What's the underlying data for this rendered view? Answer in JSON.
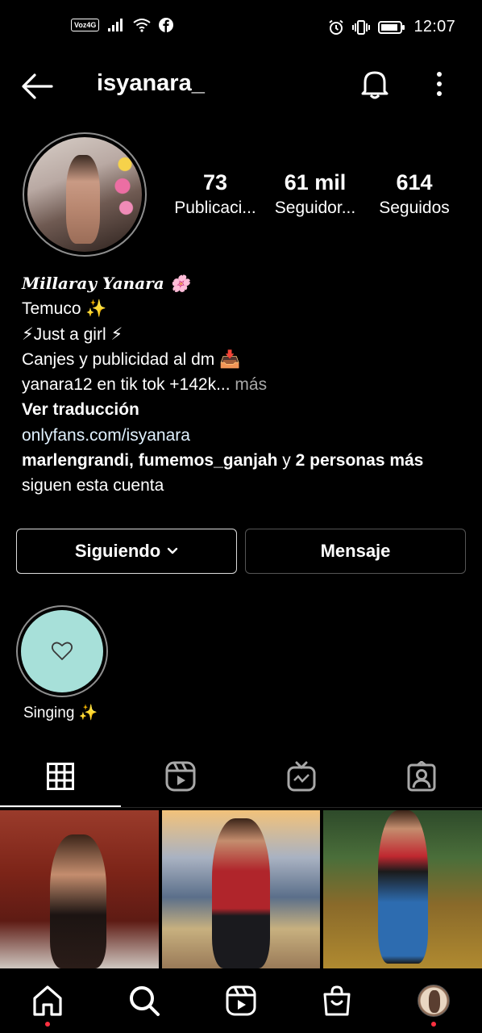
{
  "status_bar": {
    "carrier_badge": "Voz4G",
    "time": "12:07",
    "icons": [
      "signal-icon",
      "wifi-icon",
      "facebook-icon",
      "alarm-icon",
      "vibrate-icon",
      "battery-icon"
    ]
  },
  "header": {
    "username": "isyanara_",
    "icons": [
      "back-arrow-icon",
      "bell-icon",
      "more-vertical-icon"
    ]
  },
  "stats": [
    {
      "value": "73",
      "label": "Publicaci..."
    },
    {
      "value": "61 mil",
      "label": "Seguidor..."
    },
    {
      "value": "614",
      "label": "Seguidos"
    }
  ],
  "bio": {
    "display_name": "Millaray Yanara 🌸",
    "lines": [
      "Temuco ✨",
      "⚡Just a girl ⚡",
      "Canjes y publicidad al dm 📥"
    ],
    "truncated_line": "yanara12 en tik tok +142k...",
    "more_label": " más",
    "translate_label": "Ver traducción",
    "link": "onlyfans.com/isyanara",
    "followed_by_bold_1": "marlengrandi",
    "followed_by_sep": ", ",
    "followed_by_bold_2": "fumemos_ganjah",
    "followed_by_mid": " y ",
    "followed_by_bold_3": "2 personas más",
    "followed_by_tail": "siguen esta cuenta"
  },
  "actions": {
    "following_label": "Siguiendo",
    "message_label": "Mensaje"
  },
  "highlights": [
    {
      "label": "Singing ✨",
      "color": "#a7e0d9",
      "icon": "heart-icon"
    }
  ],
  "tabs": [
    "grid-icon",
    "reels-icon",
    "igtv-icon",
    "tagged-icon"
  ],
  "bottom_nav": [
    "home-icon",
    "search-icon",
    "reels-icon",
    "shop-icon",
    "profile-avatar"
  ],
  "colors": {
    "background": "#000000",
    "text": "#ffffff",
    "muted": "#a8a8a8",
    "link": "#e0f1ff",
    "notification_dot": "#ff3040"
  }
}
